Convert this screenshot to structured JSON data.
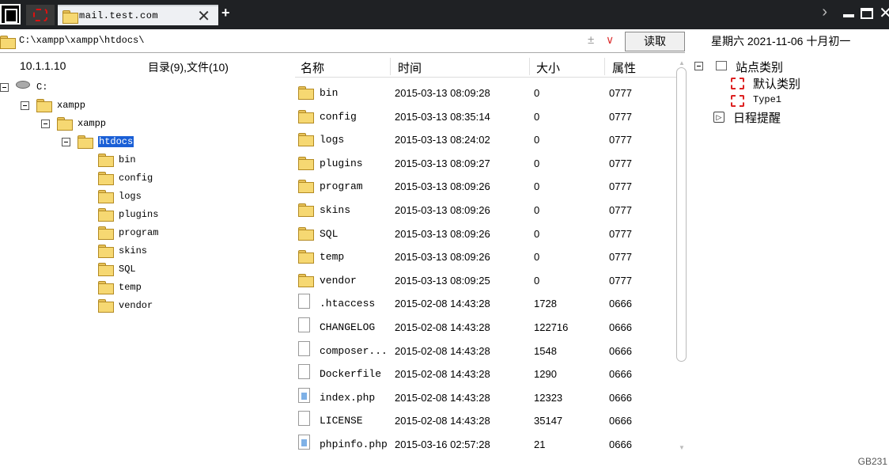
{
  "tab": {
    "title": "mail.test.com",
    "close_glyph": "✕",
    "add_glyph": "+"
  },
  "window_controls": {
    "next": "›",
    "close": "✕"
  },
  "address": {
    "path": "C:\\xampp\\xampp\\htdocs\\",
    "plusminus": "±",
    "dropdown": "∨",
    "read_button": "读取"
  },
  "datetime": "星期六 2021-11-06 十月初一",
  "tree": {
    "ip": "10.1.1.10",
    "counts": "目录(9),文件(10)",
    "nodes": [
      {
        "label": "C:",
        "icon": "drive-icon"
      },
      {
        "label": "xampp",
        "icon": "folder-icon"
      },
      {
        "label": "xampp",
        "icon": "folder-icon"
      },
      {
        "label": "htdocs",
        "icon": "folder-open-icon",
        "selected": true
      },
      {
        "label": "bin",
        "icon": "folder-icon"
      },
      {
        "label": "config",
        "icon": "folder-icon"
      },
      {
        "label": "logs",
        "icon": "folder-icon"
      },
      {
        "label": "plugins",
        "icon": "folder-icon"
      },
      {
        "label": "program",
        "icon": "folder-icon"
      },
      {
        "label": "skins",
        "icon": "folder-icon"
      },
      {
        "label": "SQL",
        "icon": "folder-icon"
      },
      {
        "label": "temp",
        "icon": "folder-icon"
      },
      {
        "label": "vendor",
        "icon": "folder-icon"
      }
    ]
  },
  "list": {
    "columns": {
      "name": "名称",
      "time": "时间",
      "size": "大小",
      "attr": "属性"
    },
    "rows": [
      {
        "name": "bin",
        "time": "2015-03-13 08:09:28",
        "size": "0",
        "attr": "0777",
        "type": "folder"
      },
      {
        "name": "config",
        "time": "2015-03-13 08:35:14",
        "size": "0",
        "attr": "0777",
        "type": "folder"
      },
      {
        "name": "logs",
        "time": "2015-03-13 08:24:02",
        "size": "0",
        "attr": "0777",
        "type": "folder"
      },
      {
        "name": "plugins",
        "time": "2015-03-13 08:09:27",
        "size": "0",
        "attr": "0777",
        "type": "folder"
      },
      {
        "name": "program",
        "time": "2015-03-13 08:09:26",
        "size": "0",
        "attr": "0777",
        "type": "folder"
      },
      {
        "name": "skins",
        "time": "2015-03-13 08:09:26",
        "size": "0",
        "attr": "0777",
        "type": "folder"
      },
      {
        "name": "SQL",
        "time": "2015-03-13 08:09:26",
        "size": "0",
        "attr": "0777",
        "type": "folder"
      },
      {
        "name": "temp",
        "time": "2015-03-13 08:09:26",
        "size": "0",
        "attr": "0777",
        "type": "folder"
      },
      {
        "name": "vendor",
        "time": "2015-03-13 08:09:25",
        "size": "0",
        "attr": "0777",
        "type": "folder"
      },
      {
        "name": ".htaccess",
        "time": "2015-02-08 14:43:28",
        "size": "1728",
        "attr": "0666",
        "type": "file"
      },
      {
        "name": "CHANGELOG",
        "time": "2015-02-08 14:43:28",
        "size": "122716",
        "attr": "0666",
        "type": "file"
      },
      {
        "name": "composer...",
        "time": "2015-02-08 14:43:28",
        "size": "1548",
        "attr": "0666",
        "type": "file"
      },
      {
        "name": "Dockerfile",
        "time": "2015-02-08 14:43:28",
        "size": "1290",
        "attr": "0666",
        "type": "file"
      },
      {
        "name": "index.php",
        "time": "2015-02-08 14:43:28",
        "size": "12323",
        "attr": "0666",
        "type": "php"
      },
      {
        "name": "LICENSE",
        "time": "2015-02-08 14:43:28",
        "size": "35147",
        "attr": "0666",
        "type": "file"
      },
      {
        "name": "phpinfo.php",
        "time": "2015-03-16 02:57:28",
        "size": "21",
        "attr": "0666",
        "type": "php"
      }
    ]
  },
  "right_panel": {
    "category_root": "站点类别",
    "categories": [
      "默认类别",
      "Type1"
    ],
    "reminder": "日程提醒"
  },
  "footer_code": "GB231"
}
